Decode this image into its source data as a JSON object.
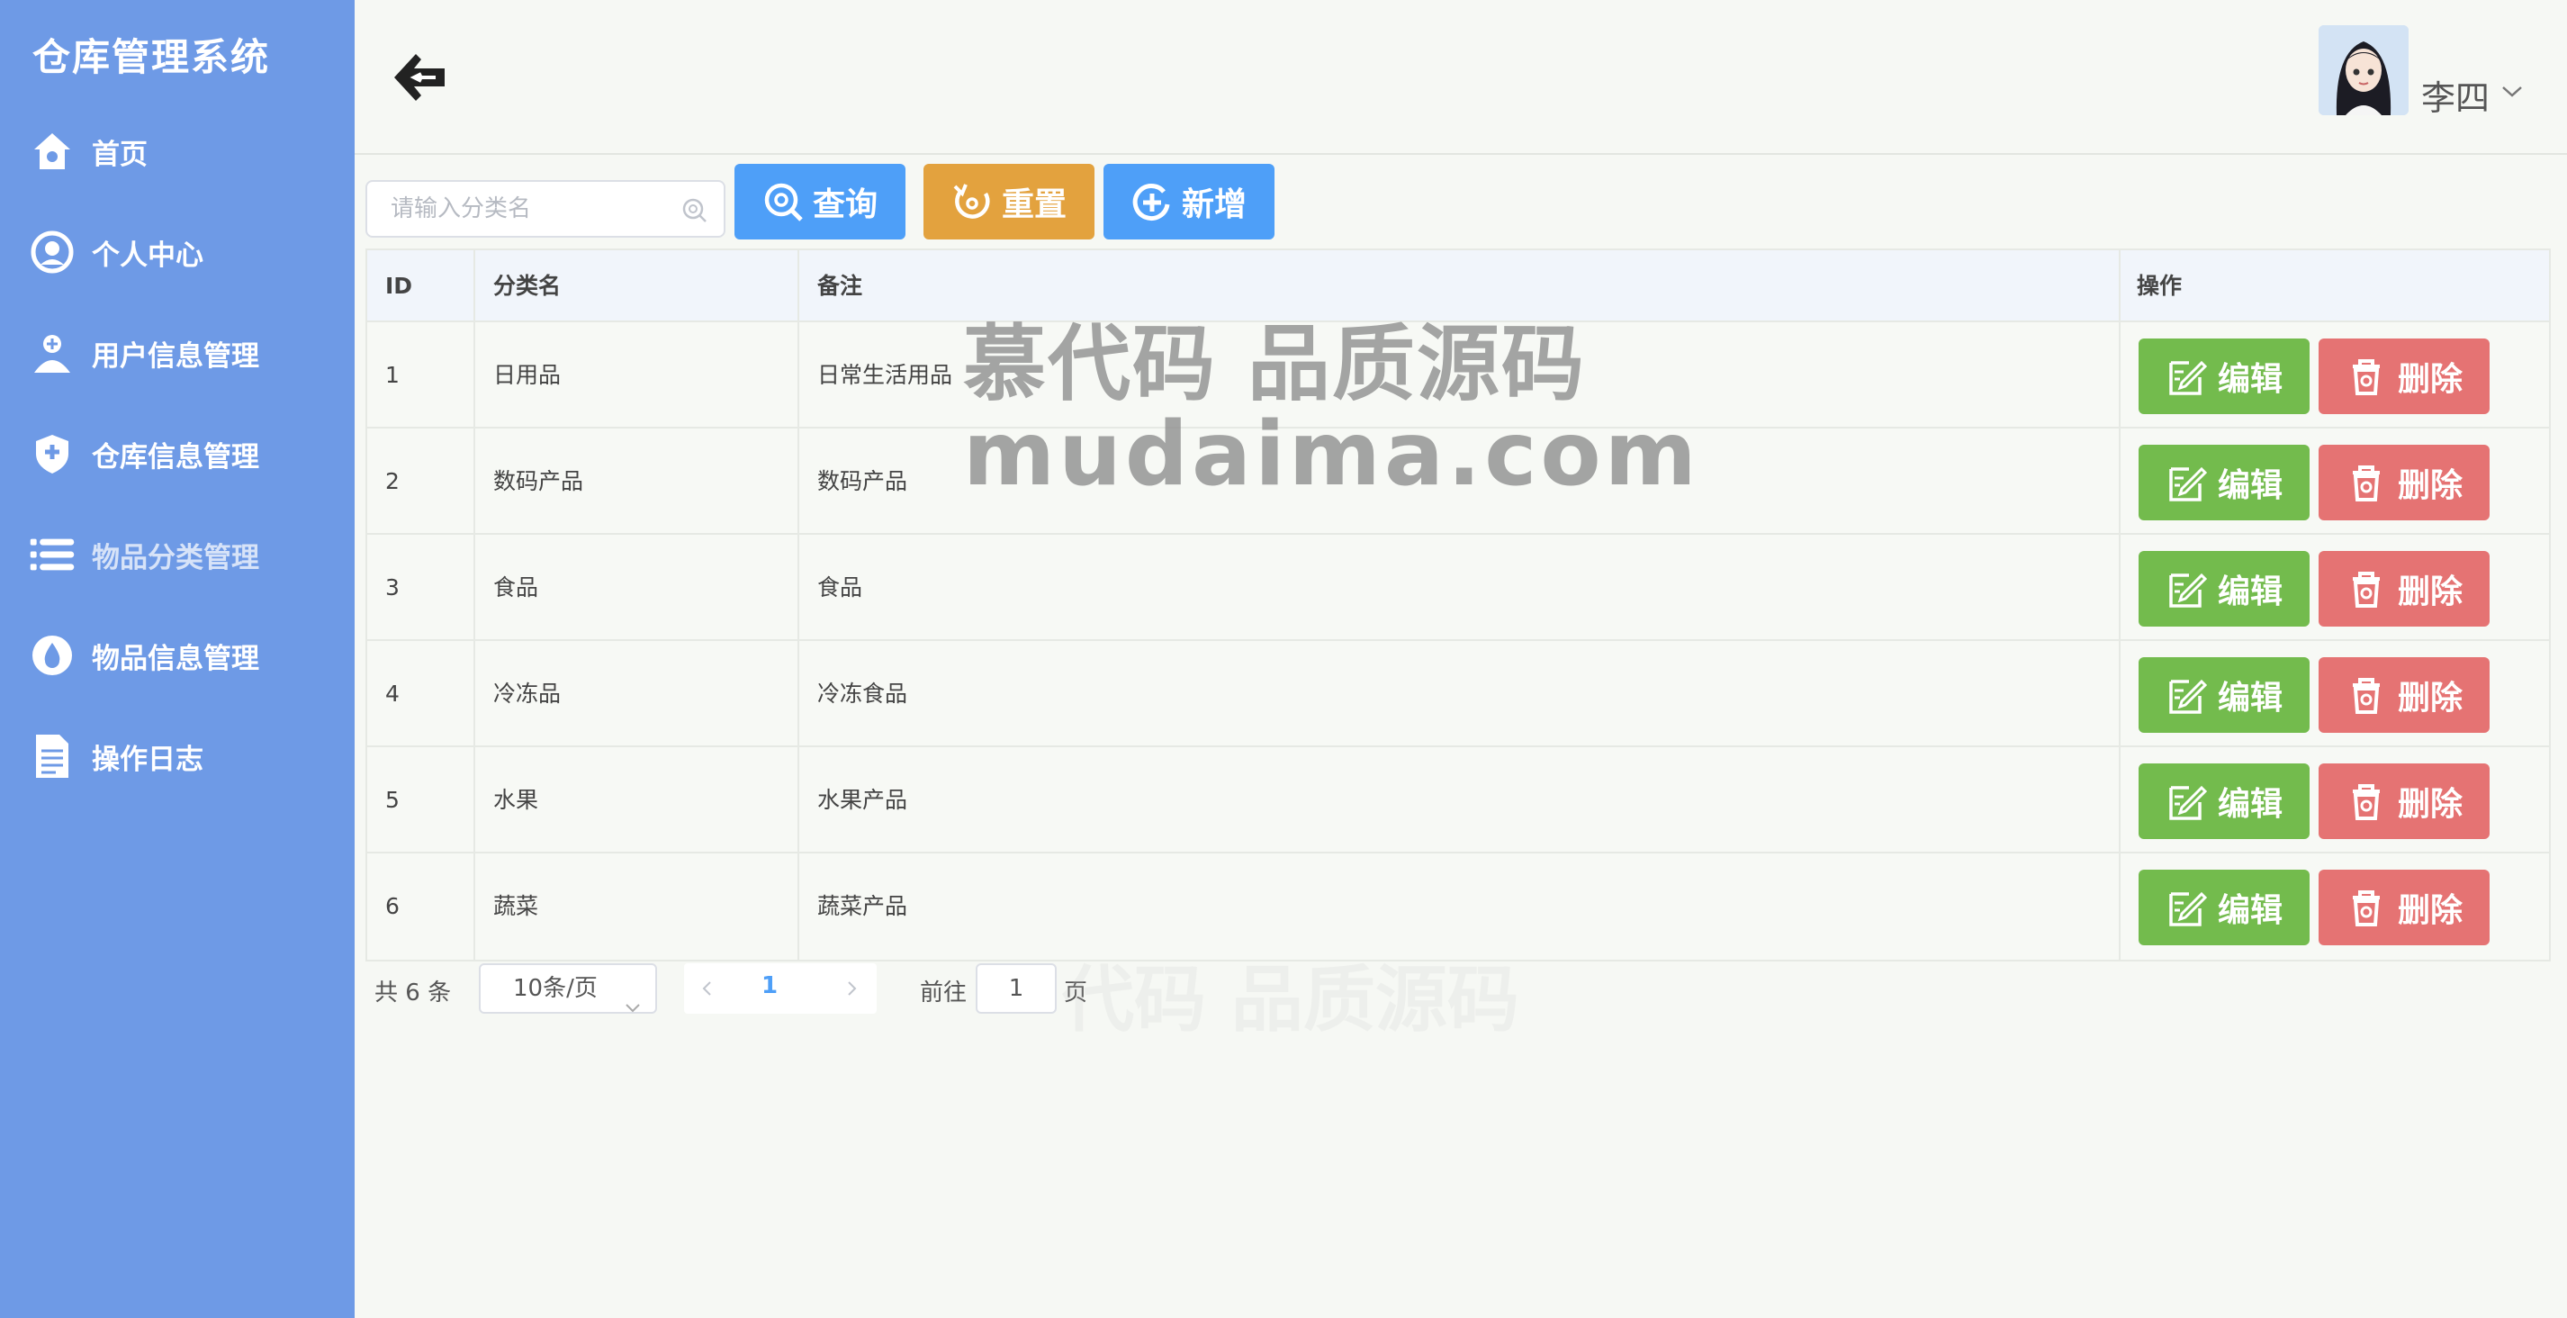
{
  "sidebar": {
    "brand": "仓库管理系统",
    "items": [
      {
        "label": "首页",
        "icon": "home-icon"
      },
      {
        "label": "个人中心",
        "icon": "user-circle-icon"
      },
      {
        "label": "用户信息管理",
        "icon": "user-plus-icon"
      },
      {
        "label": "仓库信息管理",
        "icon": "shield-plus-icon"
      },
      {
        "label": "物品分类管理",
        "icon": "list-icon",
        "active": true
      },
      {
        "label": "物品信息管理",
        "icon": "drop-icon"
      },
      {
        "label": "操作日志",
        "icon": "document-icon"
      }
    ]
  },
  "header": {
    "back_icon": "back-arrow-icon",
    "username": "李四"
  },
  "toolbar": {
    "search_placeholder": "请输入分类名",
    "search_value": "",
    "query_label": "查询",
    "reset_label": "重置",
    "add_label": "新增"
  },
  "table": {
    "columns": [
      "ID",
      "分类名",
      "备注",
      "操作"
    ],
    "rows": [
      {
        "id": "1",
        "name": "日用品",
        "note": "日常生活用品"
      },
      {
        "id": "2",
        "name": "数码产品",
        "note": "数码产品"
      },
      {
        "id": "3",
        "name": "食品",
        "note": "食品"
      },
      {
        "id": "4",
        "name": "冷冻品",
        "note": "冷冻食品"
      },
      {
        "id": "5",
        "name": "水果",
        "note": "水果产品"
      },
      {
        "id": "6",
        "name": "蔬菜",
        "note": "蔬菜产品"
      }
    ],
    "edit_label": "编辑",
    "delete_label": "删除"
  },
  "pagination": {
    "total_text": "共 6 条",
    "page_size": "10条/页",
    "current_page": "1",
    "goto_label": "前往",
    "goto_value": "1",
    "page_suffix": "页"
  },
  "watermark": {
    "line1": "慕代码 品质源码",
    "line2": "mudaima.com",
    "line3": "代码 品质源码"
  },
  "colors": {
    "sidebar_bg": "#6e9ae6",
    "primary": "#4e9ff8",
    "warning": "#e3a23e",
    "success": "#73bb4d",
    "danger": "#e57373"
  }
}
